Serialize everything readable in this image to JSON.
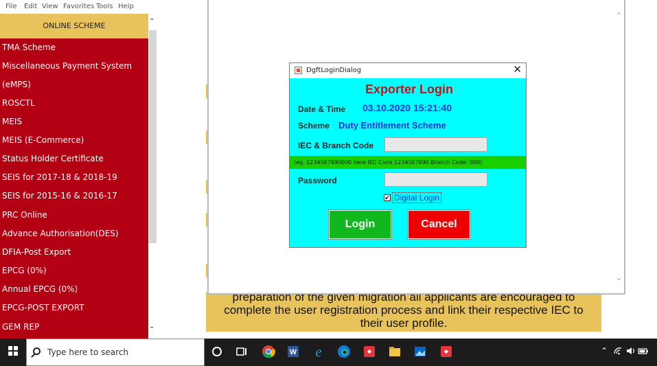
{
  "menu": [
    "File",
    "Edit",
    "View",
    "Favorites",
    "Tools",
    "Help"
  ],
  "sidebar": {
    "header": "ONLINE SCHEME",
    "items": [
      "TMA Scheme",
      "Miscellaneous Payment System",
      "(eMPS)",
      "ROSCTL",
      "MEIS",
      "MEIS (E-Commerce)",
      "Status Holder Certificate",
      "SEIS for 2017-18 & 2018-19",
      "SEIS for 2015-16 & 2016-17",
      "PRC Online",
      "Advance Authorisation(DES)",
      "DFIA-Post Export",
      "EPCG (0%)",
      "Annual EPCG (0%)",
      "EPCG-POST EXPORT",
      "GEM REP"
    ]
  },
  "banner": {
    "lines": [
      "preparation of the given migration all applicants are encouraged to",
      "complete the user registration process and link their respective IEC to",
      "their user profile."
    ]
  },
  "dialog": {
    "window_title": "DgftLoginDialog",
    "close_glyph": "✕",
    "heading": "Exporter Login",
    "date_label": "Date & Time",
    "date_value": "03.10.2020 15:21:40",
    "scheme_label": "Scheme",
    "scheme_value": "Duty Entitlement Scheme",
    "iec_label": "IEC & Branch Code",
    "iec_value": "",
    "hint": "(eg. 1234567890000 here IEC Code 1234567890 Branch Code: 000)",
    "password_label": "Password",
    "password_value": "",
    "digital_login_label": "Digital Login",
    "digital_login_checked": true,
    "login_label": "Login",
    "cancel_label": "Cancel"
  },
  "taskbar": {
    "search_placeholder": "Type here to search",
    "colors": {
      "background": "#1c1c1c"
    }
  },
  "colors": {
    "sidebar": "#b30012",
    "sidebar_header": "#e8c25b",
    "dialog_body": "#00ffff",
    "heading": "#c0141b",
    "hint_bar": "#18d000",
    "login_button": "#10b81e",
    "cancel_button": "#ee0000"
  }
}
